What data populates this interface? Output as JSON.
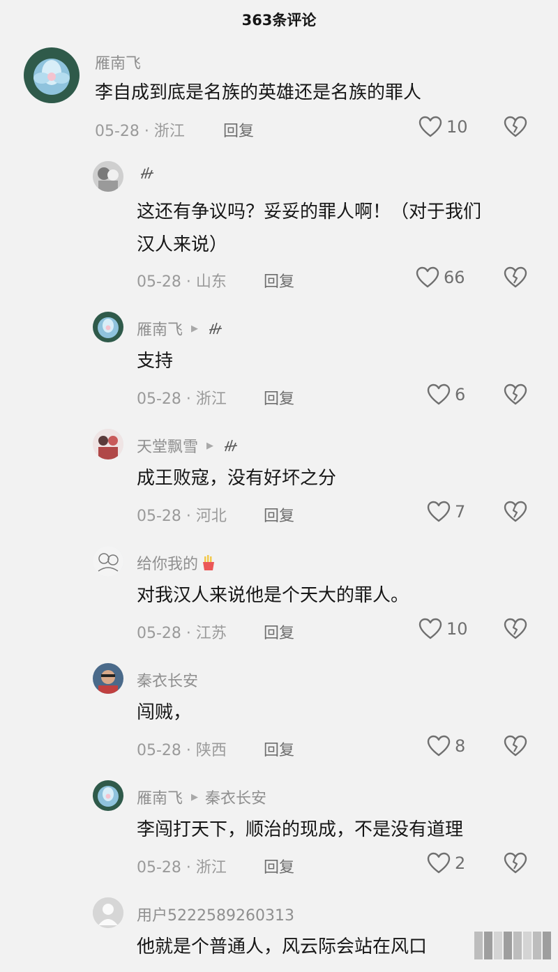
{
  "header": {
    "title": "363条评论"
  },
  "comments": [
    {
      "user": "雁南飞",
      "reply_to": "",
      "text": "李自成到底是名族的英雄还是名族的罪人",
      "text2": "",
      "meta": "05-28 · 浙江",
      "reply": "回复",
      "likes": "10"
    },
    {
      "user": "",
      "reply_to": "",
      "text": "这还有争议吗？妥妥的罪人啊！（对于我们",
      "text2": "汉人来说）",
      "meta": "05-28 · 山东",
      "reply": "回复",
      "likes": "66"
    },
    {
      "user": "雁南飞",
      "reply_to": "",
      "text": "支持",
      "text2": "",
      "meta": "05-28 · 浙江",
      "reply": "回复",
      "likes": "6"
    },
    {
      "user": "天堂飘雪",
      "reply_to": "",
      "text": "成王败寇，没有好坏之分",
      "text2": "",
      "meta": "05-28 · 河北",
      "reply": "回复",
      "likes": "7"
    },
    {
      "user": "给你我的",
      "reply_to": "",
      "text": "对我汉人来说他是个天大的罪人。",
      "text2": "",
      "meta": "05-28 · 江苏",
      "reply": "回复",
      "likes": "10"
    },
    {
      "user": "秦衣长安",
      "reply_to": "",
      "text": "闯贼，",
      "text2": "",
      "meta": "05-28 · 陕西",
      "reply": "回复",
      "likes": "8"
    },
    {
      "user": "雁南飞",
      "reply_to": "秦衣长安",
      "text": "李闯打天下，顺治的现成，不是没有道理",
      "text2": "",
      "meta": "05-28 · 浙江",
      "reply": "回复",
      "likes": "2"
    },
    {
      "user": "用户5222589260313",
      "reply_to": "",
      "text": "他就是个普通人，风云际会站在风口",
      "text2": "",
      "meta": "",
      "reply": "",
      "likes": ""
    }
  ],
  "icons": {
    "like": "heart-outline-icon",
    "dislike": "broken-heart-icon",
    "reply_arrow": "triangle-right-icon"
  },
  "colors": {
    "background": "#f2f2f2",
    "name": "#8f8f8f",
    "text": "#161616"
  }
}
